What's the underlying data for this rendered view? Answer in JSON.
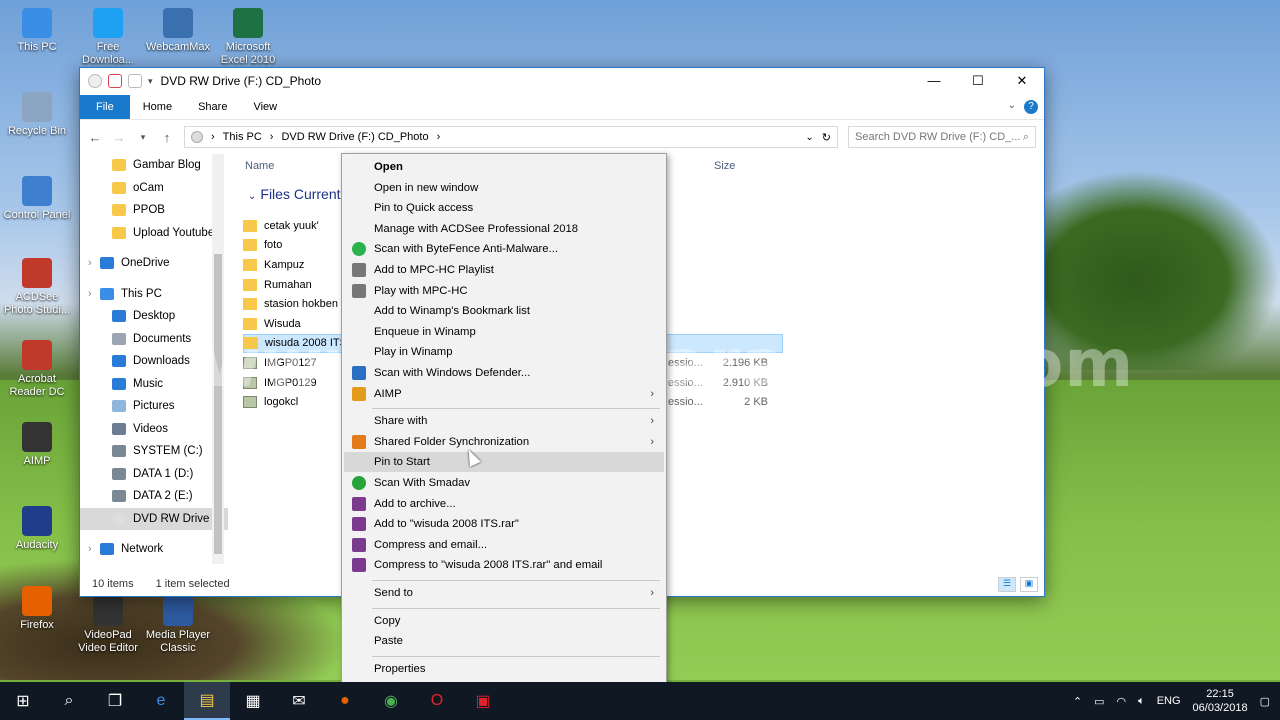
{
  "desktop": {
    "icons": [
      {
        "label": "This PC",
        "icon": "monitor-icon"
      },
      {
        "label": "Free Downloa...",
        "icon": "download-icon"
      },
      {
        "label": "WebcamMax",
        "icon": "webcam-icon"
      },
      {
        "label": "Microsoft Excel 2010",
        "icon": "excel-icon"
      },
      {
        "label": "Recycle Bin",
        "icon": "recycle-bin-icon"
      },
      {
        "label": "Control Panel",
        "icon": "control-panel-icon"
      },
      {
        "label": "ACDSee Photo Studi...",
        "icon": "acdsee-icon"
      },
      {
        "label": "Acrobat Reader DC",
        "icon": "acrobat-icon"
      },
      {
        "label": "AIMP",
        "icon": "aimp-icon"
      },
      {
        "label": "Audacity",
        "icon": "audacity-icon"
      },
      {
        "label": "Firefox",
        "icon": "firefox-icon"
      },
      {
        "label": "VideoPad Video Editor",
        "icon": "videopad-icon"
      },
      {
        "label": "Media Player Classic",
        "icon": "mpc-icon"
      }
    ]
  },
  "window": {
    "title": "DVD RW Drive (F:) CD_Photo",
    "ribbon_tabs": [
      "File",
      "Home",
      "Share",
      "View"
    ],
    "breadcrumb": [
      "This PC",
      "DVD RW Drive (F:) CD_Photo"
    ],
    "search_placeholder": "Search DVD RW Drive (F:) CD_...",
    "nav_items": [
      {
        "label": "Gambar Blog",
        "kind": "folder"
      },
      {
        "label": "oCam",
        "kind": "folder"
      },
      {
        "label": "PPOB",
        "kind": "folder"
      },
      {
        "label": "Upload Youtube",
        "kind": "folder"
      },
      {
        "label": "",
        "kind": "spacer"
      },
      {
        "label": "OneDrive",
        "kind": "cloud"
      },
      {
        "label": "",
        "kind": "spacer"
      },
      {
        "label": "This PC",
        "kind": "pc"
      },
      {
        "label": "Desktop",
        "kind": "desktop"
      },
      {
        "label": "Documents",
        "kind": "docs"
      },
      {
        "label": "Downloads",
        "kind": "downloads"
      },
      {
        "label": "Music",
        "kind": "music"
      },
      {
        "label": "Pictures",
        "kind": "pictures"
      },
      {
        "label": "Videos",
        "kind": "videos"
      },
      {
        "label": "SYSTEM (C:)",
        "kind": "drive"
      },
      {
        "label": "DATA 1 (D:)",
        "kind": "drive"
      },
      {
        "label": "DATA 2 (E:)",
        "kind": "drive"
      },
      {
        "label": "DVD RW Drive (F",
        "kind": "dvd"
      },
      {
        "label": "",
        "kind": "spacer"
      },
      {
        "label": "Network",
        "kind": "network"
      }
    ],
    "columns": {
      "name": "Name",
      "size": "Size"
    },
    "group_label": "Files Currently o",
    "files": [
      {
        "name": "cetak yuuk'",
        "kind": "folder",
        "meta": "",
        "size": ""
      },
      {
        "name": "foto",
        "kind": "folder",
        "meta": "",
        "size": ""
      },
      {
        "name": "Kampuz",
        "kind": "folder",
        "meta": "",
        "size": ""
      },
      {
        "name": "Rumahan",
        "kind": "folder",
        "meta": "",
        "size": ""
      },
      {
        "name": "stasion hokben",
        "kind": "folder",
        "meta": "",
        "size": ""
      },
      {
        "name": "Wisuda",
        "kind": "folder",
        "meta": "",
        "size": ""
      },
      {
        "name": "wisuda 2008 ITS",
        "kind": "folder",
        "meta": "",
        "size": ""
      },
      {
        "name": "IMGP0127",
        "kind": "image",
        "meta": "essio...",
        "size": "2.196 KB"
      },
      {
        "name": "IMGP0129",
        "kind": "image",
        "meta": "essio...",
        "size": "2.910 KB"
      },
      {
        "name": "logokcl",
        "kind": "image",
        "meta": "essio...",
        "size": "2 KB"
      }
    ],
    "status_count": "10 items",
    "status_selected": "1 item selected"
  },
  "context_menu": [
    {
      "label": "Open",
      "bold": true
    },
    {
      "label": "Open in new window"
    },
    {
      "label": "Pin to Quick access"
    },
    {
      "label": "Manage with ACDSee Professional 2018"
    },
    {
      "label": "Scan with ByteFence Anti-Malware...",
      "icon": "shield-icon",
      "color": "#2bb24c"
    },
    {
      "label": "Add to MPC-HC Playlist",
      "icon": "film-icon",
      "color": "#777777"
    },
    {
      "label": "Play with MPC-HC",
      "icon": "film-icon",
      "color": "#777777"
    },
    {
      "label": "Add to Winamp's Bookmark list"
    },
    {
      "label": "Enqueue in Winamp"
    },
    {
      "label": "Play in Winamp"
    },
    {
      "label": "Scan with Windows Defender...",
      "icon": "defender-icon",
      "color": "#2a6fc4"
    },
    {
      "label": "AIMP",
      "icon": "aimp-icon",
      "color": "#e39a1d",
      "submenu": true
    },
    {
      "sep": true
    },
    {
      "label": "Share with",
      "submenu": true
    },
    {
      "label": "Shared Folder Synchronization",
      "icon": "sync-icon",
      "color": "#e37b1d",
      "submenu": true
    },
    {
      "label": "Pin to Start",
      "highlight": true
    },
    {
      "label": "Scan With Smadav",
      "icon": "smadav-icon",
      "color": "#27a33a"
    },
    {
      "label": "Add to archive...",
      "icon": "winrar-icon",
      "color": "#7a3b8f"
    },
    {
      "label": "Add to \"wisuda 2008 ITS.rar\"",
      "icon": "winrar-icon",
      "color": "#7a3b8f"
    },
    {
      "label": "Compress and email...",
      "icon": "winrar-icon",
      "color": "#7a3b8f"
    },
    {
      "label": "Compress to \"wisuda 2008 ITS.rar\" and email",
      "icon": "winrar-icon",
      "color": "#7a3b8f"
    },
    {
      "sep": true
    },
    {
      "label": "Send to",
      "submenu": true
    },
    {
      "sep": true
    },
    {
      "label": "Copy"
    },
    {
      "label": "Paste"
    },
    {
      "sep": true
    },
    {
      "label": "Properties"
    }
  ],
  "watermark": "www.pusatcaracara.com",
  "taskbar": {
    "apps": [
      "start-icon",
      "search-icon",
      "task-view-icon",
      "edge-icon",
      "file-explorer-icon",
      "store-icon",
      "mail-icon",
      "firefox-icon",
      "chrome-icon",
      "opera-icon",
      "acdsee-icon"
    ],
    "tray_lang": "ENG",
    "time": "22:15",
    "date": "06/03/2018"
  }
}
